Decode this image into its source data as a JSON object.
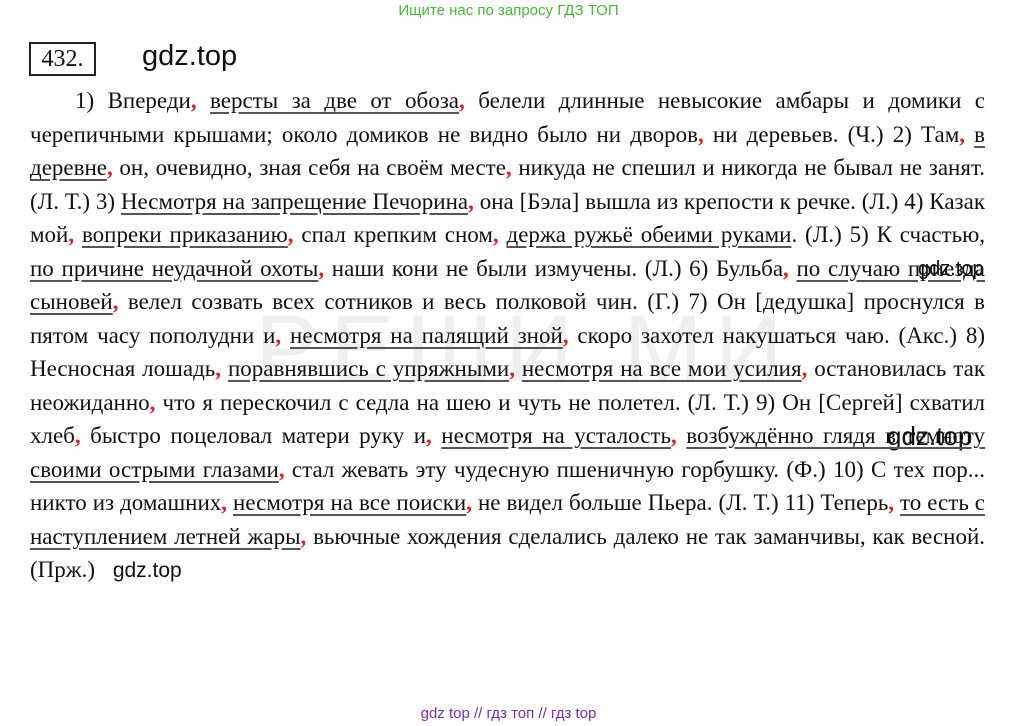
{
  "header": {
    "banner": "Ищите нас по запросу ГДЗ ТОП"
  },
  "exercise": {
    "number": "432."
  },
  "logos": {
    "top": "gdz.top",
    "inline1": "gdz.top",
    "inline2": "gdz.top",
    "end": "gdz.top"
  },
  "background_word": "РЕШИ МИ",
  "text": {
    "s1a": "1) Впереди",
    "s1b": "версты за две от обоза",
    "s1c": "белели длинные невысокие амбары и домики с черепичными крышами; около домиков не видно было ни дворов",
    "s1d": "ни деревьев. (Ч.) 2) Там",
    "s2a": "в деревне",
    "s2b": "он, очевидно, зная себя на своём месте",
    "s2c": "никуда не спешил и никогда не бывал не занят. (Л. Т.) 3)",
    "s3a": "Несмотря на запрещение Печорина",
    "s3b": "она [Бэла] вышла из крепости к речке. (Л.) 4) Казак мой",
    "s4a": "вопреки приказанию",
    "s4b": "спал крепким сном",
    "s4c": "держа ружьё обеими руками",
    "s4d": ". (Л.) 5) К счастью,",
    "s5a": "по причине неудачной охоты",
    "s5b": "наши кони не были измучены. (Л.) 6) Бульба",
    "s6a": "по случаю приезда сыновей",
    "s6b": "велел созвать всех сотников и весь полковой чин. (Г.) 7) Он [дедушка] проснулся в пятом часу пополудни и",
    "s7a": "несмотря на палящий зной",
    "s7b": "скоро захотел накушаться чаю. (Акс.) 8) Несносная лошадь",
    "s8a": "поравнявшись с упряжными",
    "s8b": "несмотря на все мои усилия",
    "s8c": "остановилась так неожиданно",
    "s8d": "что я перескочил с седла на шею и чуть не полетел. (Л. Т.) 9) Он [Сергей] схватил хлеб",
    "s9a": "быстро поцеловал матери руку и",
    "s9b": "несмотря на усталость",
    "s9c": "возбуждённо глядя в темноту своими острыми глазами",
    "s9d": "стал жевать эту чудесную пшеничную горбушку. (Ф.) 10) С тех пор... никто из домашних",
    "s10a": "несмотря на все поиски",
    "s10b": "не видел больше Пьера. (Л. Т.) 11) Теперь",
    "s11a": "то есть с наступлением летней жары",
    "s11b": "вьючные хождения сделались далеко не так заманчивы, как весной. (Прж.)"
  },
  "footer": {
    "links": "gdz top // гдз топ // гдз top"
  },
  "colors": {
    "comma": "#e02020",
    "banner": "#3fbe2e",
    "footer": "#7a2fb0"
  }
}
